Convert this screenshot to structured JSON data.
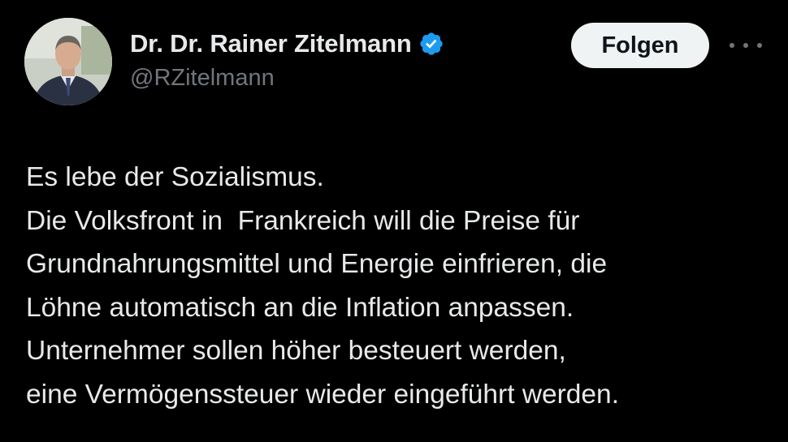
{
  "author": {
    "display_name": "Dr. Dr. Rainer Zitelmann",
    "handle": "@RZitelmann",
    "verified_icon": "verified-badge-icon",
    "avatar_icon": "avatar-photo"
  },
  "actions": {
    "follow_label": "Folgen",
    "more_icon": "more-options-icon"
  },
  "tweet": {
    "lines": [
      "Es lebe der Sozialismus.",
      "Die Volksfront in  Frankreich will die Preise für",
      "Grundnahrungsmittel und Energie einfrieren, die",
      "Löhne automatisch an die Inflation anpassen.",
      "Unternehmer sollen höher besteuert werden,",
      "eine Vermögenssteuer wieder eingeführt werden."
    ]
  },
  "colors": {
    "background": "#000000",
    "text_primary": "#e7e9ea",
    "text_secondary": "#71767b",
    "verified_blue": "#1d9bf0",
    "follow_bg": "#eff3f4"
  }
}
